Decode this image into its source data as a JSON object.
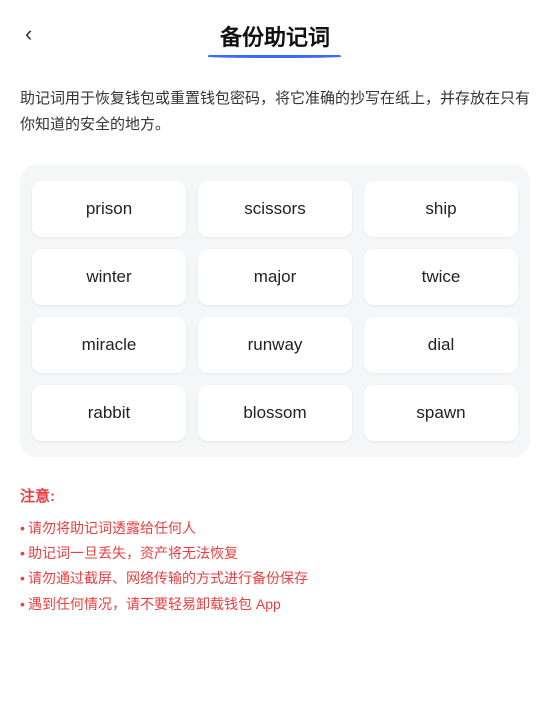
{
  "header": {
    "back_label": "‹",
    "title": "备份助记词",
    "title_underline": true
  },
  "description": "助记词用于恢复钱包或重置钱包密码，将它准确的抄写在纸上，并存放在只有你知道的安全的地方。",
  "mnemonic": {
    "words": [
      "prison",
      "scissors",
      "ship",
      "winter",
      "major",
      "twice",
      "miracle",
      "runway",
      "dial",
      "rabbit",
      "blossom",
      "spawn"
    ]
  },
  "notes": {
    "title": "注意:",
    "items": [
      "请勿将助记词透露给任何人",
      "助记词一旦丢失，资产将无法恢复",
      "请勿通过截屏、网络传输的方式进行备份保存",
      "遇到任何情况，请不要轻易卸载钱包 App"
    ]
  }
}
